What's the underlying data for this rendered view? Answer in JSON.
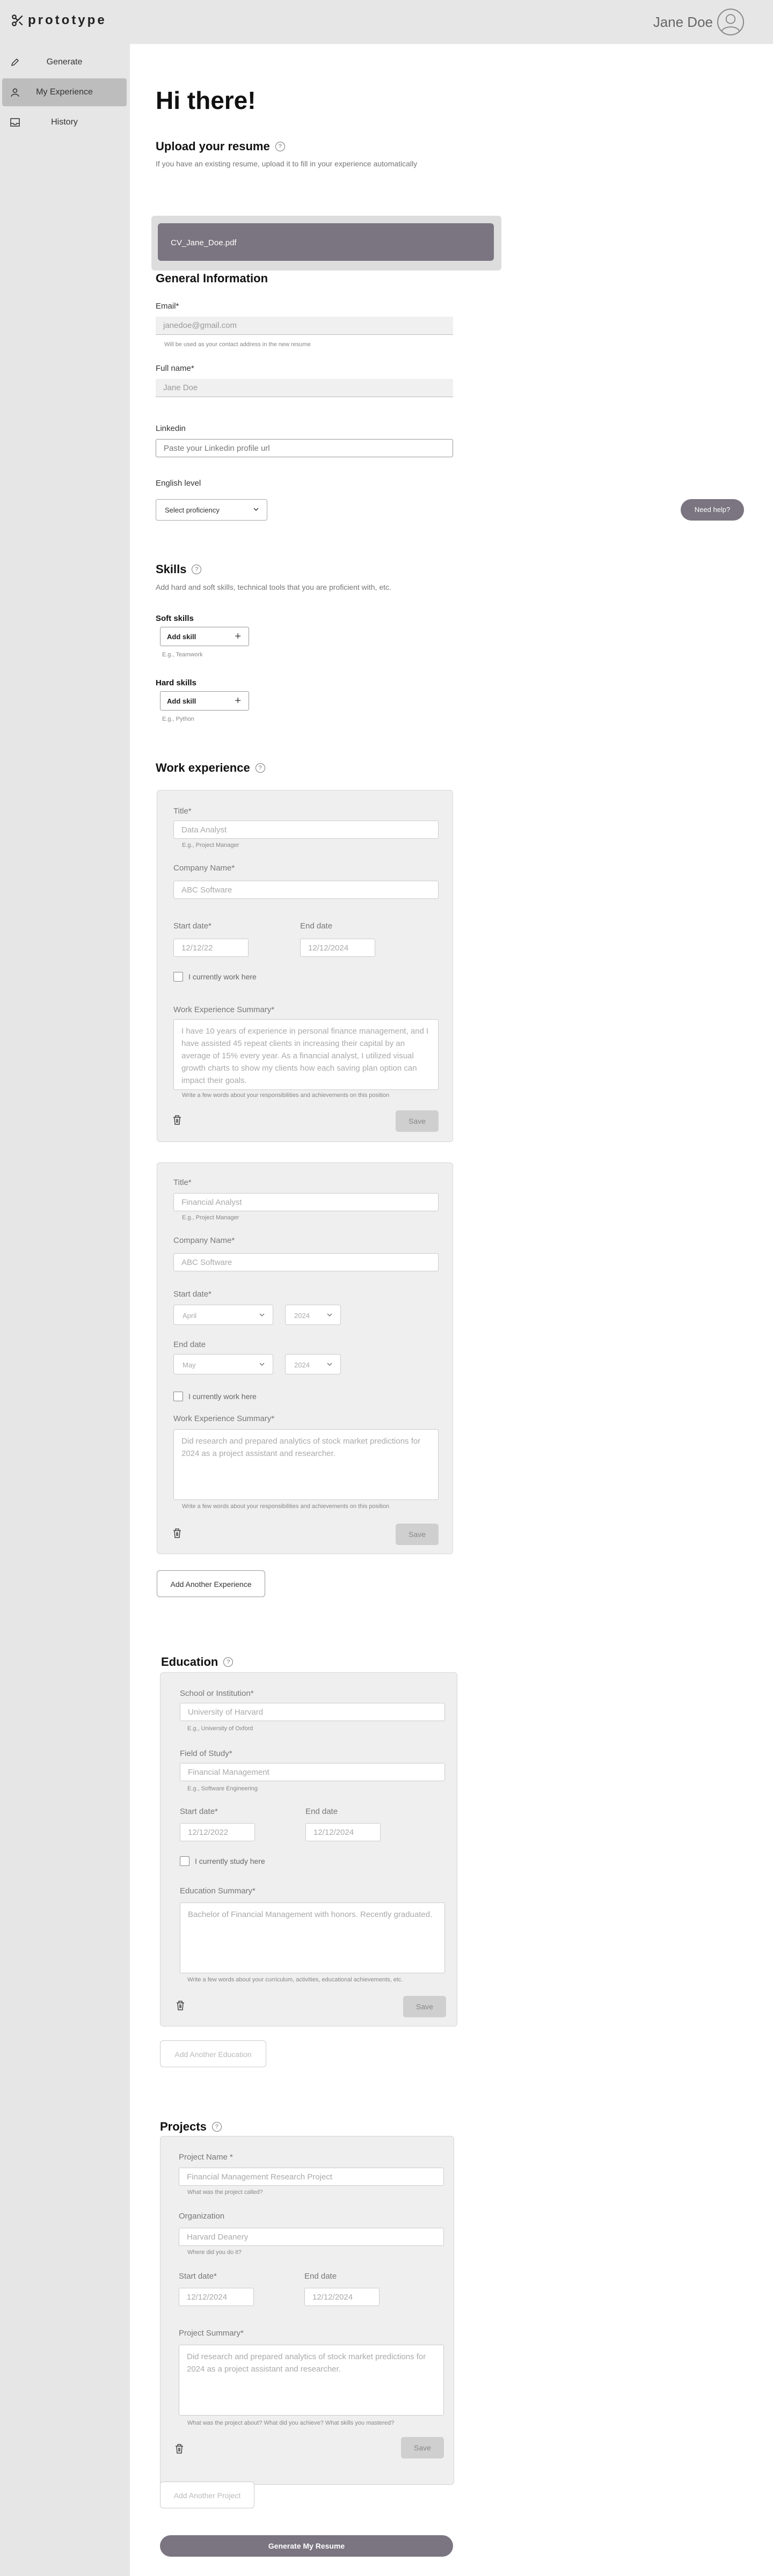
{
  "app": {
    "brand": "prototype",
    "user_name": "Jane Doe"
  },
  "sidebar": {
    "items": [
      {
        "label": "Generate",
        "icon": "pencil-icon"
      },
      {
        "label": "My Experience",
        "icon": "person-icon",
        "active": true
      },
      {
        "label": "History",
        "icon": "inbox-icon"
      }
    ]
  },
  "greeting": "Hi there!",
  "upload": {
    "title": "Upload your resume",
    "subtitle": "If you have an existing resume, upload it to fill in your experience automatically",
    "file_name": "CV_Jane_Doe.pdf"
  },
  "general": {
    "title": "General Information",
    "email_label": "Email*",
    "email_value": "janedoe@gmail.com",
    "email_hint": "Will be used as your contact address in the new resume",
    "name_label": "Full name*",
    "name_value": "Jane Doe",
    "linkedin_label": "Linkedin",
    "linkedin_placeholder": "Paste your Linkedin profile url",
    "english_label": "English level",
    "english_select": "Select proficiency",
    "help_button": "Need help?"
  },
  "skills": {
    "title": "Skills",
    "subtitle": "Add hard and soft skills, technical tools that you are proficient with, etc.",
    "soft_label": "Soft skills",
    "soft_button": "Add skill",
    "soft_hint": "E.g., Teamwork",
    "hard_label": "Hard skills",
    "hard_button": "Add skill",
    "hard_hint": "E.g., Python"
  },
  "work": {
    "title": "Work experience",
    "cards": [
      {
        "title_label": "Title*",
        "title_value": "Data Analyst",
        "title_hint": "E.g., Project Manager",
        "company_label": "Company Name*",
        "company_value": "ABC Software",
        "start_label": "Start date*",
        "start_value": "12/12/22",
        "end_label": "End date",
        "end_value": "12/12/2024",
        "current_label": "I currently work here",
        "summary_label": "Work Experience Summary*",
        "summary_value": "I have 10 years of experience in personal finance management, and I have assisted 45 repeat clients in increasing their capital by an average of 15% every year. As a financial analyst, I utilized visual growth charts to show my clients how each saving plan option can impact their goals.",
        "summary_hint": "Write a few words about your responsibilities and achievements on this position",
        "save": "Save"
      },
      {
        "title_label": "Title*",
        "title_value": "Financial Analyst",
        "title_hint": "E.g., Project Manager",
        "company_label": "Company Name*",
        "company_value": "ABC Software",
        "start_label": "Start date*",
        "start_month": "April",
        "start_year": "2024",
        "end_label": "End date",
        "end_month": "May",
        "end_year": "2024",
        "current_label": "I currently work here",
        "summary_label": "Work Experience Summary*",
        "summary_value": "Did research and prepared analytics of stock market predictions for 2024 as a project assistant and researcher.",
        "summary_hint": "Write a few words about your responsibilities and achievements on this position",
        "save": "Save"
      }
    ],
    "add_button": "Add Another Experience"
  },
  "education": {
    "title": "Education",
    "school_label": "School or Institution*",
    "school_value": "University of Harvard",
    "school_hint": "E.g., University of Oxford",
    "field_label": "Field of Study*",
    "field_value": "Financial Management",
    "field_hint": "E.g., Software Engineering",
    "start_label": "Start date*",
    "start_value": "12/12/2022",
    "end_label": "End date",
    "end_value": "12/12/2024",
    "current_label": "I currently study here",
    "summary_label": "Education Summary*",
    "summary_value": "Bachelor of Financial Management with honors. Recently graduated.",
    "summary_hint": "Write a few words about your curriculum, activities, educational achievements, etc.",
    "save": "Save",
    "add_button": "Add Another Education"
  },
  "projects": {
    "title": "Projects",
    "name_label": "Project Name *",
    "name_value": "Financial Management Research Project",
    "name_hint": "What was the project called?",
    "org_label": "Organization",
    "org_value": "Harvard Deanery",
    "org_hint": "Where did you do it?",
    "start_label": "Start date*",
    "start_value": "12/12/2024",
    "end_label": "End date",
    "end_value": "12/12/2024",
    "summary_label": "Project Summary*",
    "summary_value": "Did research and prepared analytics of stock market predictions for 2024 as a project assistant and researcher.",
    "summary_hint": "What was the project about? What did you achieve? What skills you mastered?",
    "save": "Save",
    "add_button": "Add Another Project"
  },
  "generate_button": "Generate My Resume"
}
